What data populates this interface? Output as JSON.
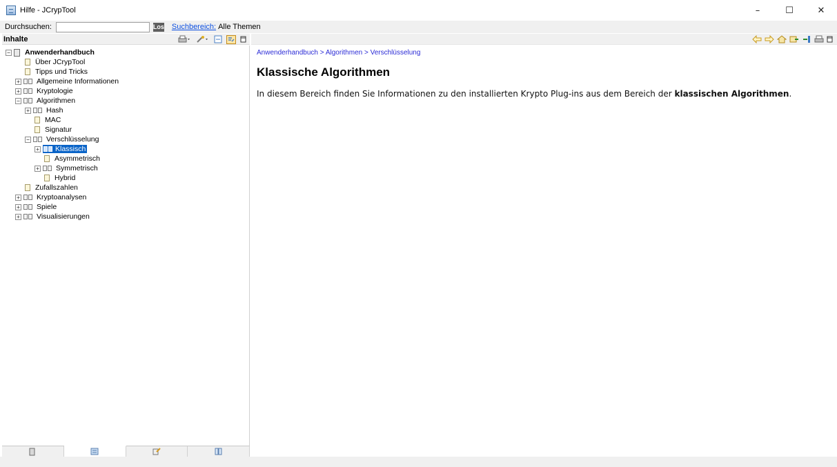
{
  "window": {
    "title": "Hilfe - JCrypTool",
    "minimize": "–",
    "maximize": "☐",
    "close": "✕"
  },
  "search": {
    "label": "Durchsuchen:",
    "value": "",
    "go": "Los",
    "scope_link": "Suchbereich:",
    "scope_value": "Alle Themen"
  },
  "left_panel": {
    "header": "Inhalte",
    "tree": [
      {
        "label": "Anwenderhandbuch",
        "icon": "manual-icon",
        "expander": "−",
        "bold": true
      },
      {
        "label": "Über JCrypTool",
        "icon": "page-icon"
      },
      {
        "label": "Tipps und Tricks",
        "icon": "page-icon"
      },
      {
        "label": "Allgemeine Informationen",
        "icon": "book-icon",
        "expander": "+"
      },
      {
        "label": "Kryptologie",
        "icon": "book-icon",
        "expander": "+"
      },
      {
        "label": "Algorithmen",
        "icon": "book-icon",
        "expander": "−"
      },
      {
        "label": "Hash",
        "icon": "book-icon",
        "expander": "+"
      },
      {
        "label": "MAC",
        "icon": "page-icon"
      },
      {
        "label": "Signatur",
        "icon": "page-icon"
      },
      {
        "label": "Verschlüsselung",
        "icon": "book-icon",
        "expander": "−"
      },
      {
        "label": "Klassisch",
        "icon": "book-icon",
        "expander": "+",
        "selected": true
      },
      {
        "label": "Asymmetrisch",
        "icon": "page-icon"
      },
      {
        "label": "Symmetrisch",
        "icon": "book-icon",
        "expander": "+"
      },
      {
        "label": "Hybrid",
        "icon": "page-icon"
      },
      {
        "label": "Zufallszahlen",
        "icon": "page-icon"
      },
      {
        "label": "Kryptoanalysen",
        "icon": "book-icon",
        "expander": "+"
      },
      {
        "label": "Spiele",
        "icon": "book-icon",
        "expander": "+"
      },
      {
        "label": "Visualisierungen",
        "icon": "book-icon",
        "expander": "+"
      }
    ]
  },
  "content": {
    "breadcrumb": [
      "Anwenderhandbuch",
      "Algorithmen",
      "Verschlüsselung"
    ],
    "breadcrumb_sep": ">",
    "title": "Klassische Algorithmen",
    "text_before": "In diesem Bereich finden Sie Informationen zu den installierten Krypto Plug-ins aus dem Bereich der ",
    "text_bold": "klassischen Algorithmen",
    "text_after": "."
  },
  "colors": {
    "selection": "#0a64c8",
    "link": "#2b2bd6",
    "panel_bg": "#f0f0f0"
  }
}
